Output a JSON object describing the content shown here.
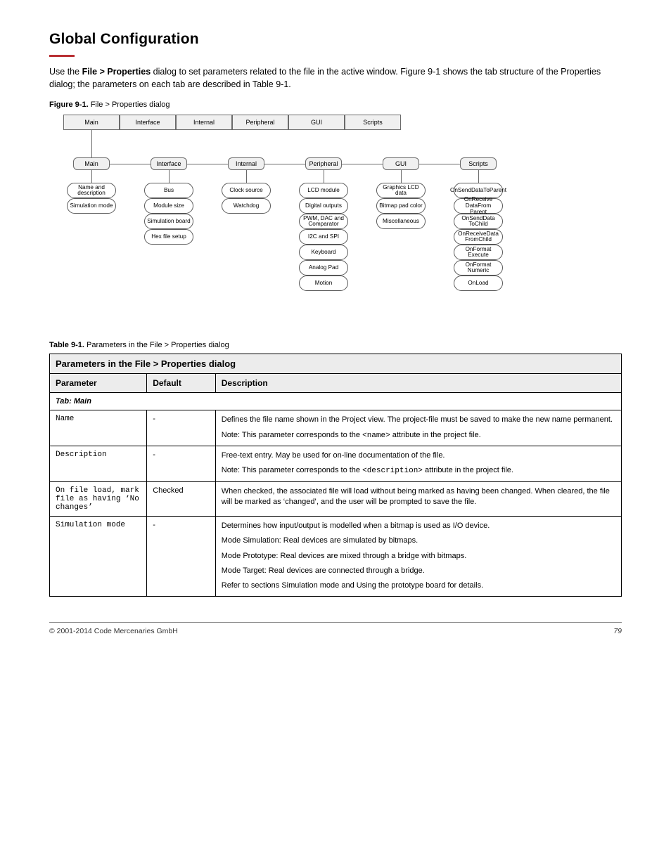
{
  "title": "Global Configuration",
  "intro_parts": [
    "Use the ",
    "File > Properties",
    " dialog to set parameters related to the file in the active window. ",
    "Figure 9-1",
    " shows the tab structure of the Properties dialog; the parameters on each tab are described in ",
    "Table 9-1",
    "."
  ],
  "figure": {
    "label": "Figure 9-1.",
    "caption": "File > Properties dialog"
  },
  "diagram": {
    "top_tabs": [
      "Main",
      "Interface",
      "Internal",
      "Peripheral",
      "GUI",
      "Scripts"
    ],
    "branches": [
      {
        "label": "Main",
        "pills": [
          "Name and description",
          "Simulation mode"
        ]
      },
      {
        "label": "Interface",
        "pills": [
          "Bus",
          "Module size",
          "Simulation board",
          "Hex file setup"
        ]
      },
      {
        "label": "Internal",
        "pills": [
          "Clock source",
          "Watchdog"
        ]
      },
      {
        "label": "Peripheral",
        "pills": [
          "LCD module",
          "Digital outputs",
          "PWM, DAC and Comparator",
          "I2C and SPI",
          "Keyboard",
          "Analog Pad",
          "Motion"
        ]
      },
      {
        "label": "GUI",
        "pills": [
          "Graphics LCD data",
          "Bitmap pad color",
          "Miscellaneous"
        ]
      },
      {
        "label": "Scripts",
        "pills": [
          "OnSendDataToParent",
          "OnReceive DataFrom Parent",
          "OnSendData ToChild",
          "OnReceiveData FromChild",
          "OnFormat Execute",
          "OnFormat Numeric",
          "OnLoad"
        ]
      }
    ]
  },
  "table": {
    "label": "Table 9-1.",
    "caption": "Parameters in the File > Properties dialog",
    "title": "Parameters in the File > Properties dialog",
    "columns": [
      "Parameter",
      "Default",
      "Description"
    ],
    "group": "Tab: Main",
    "rows": [
      {
        "param": "Name",
        "default": "-",
        "desc": [
          "Defines the file name shown in the Project view. The project-file must be saved to make the new name permanent.",
          "Note: This parameter corresponds to the <name> attribute in the project file."
        ],
        "mono_in_desc": "<name>"
      },
      {
        "param": "Description",
        "default": "-",
        "desc": [
          "Free-text entry. May be used for on-line documentation of the file.",
          "Note: This parameter corresponds to the <description> attribute in the project file."
        ],
        "mono_in_desc": "<description>"
      },
      {
        "param": "On file load, mark file as having ‘No changes’",
        "default": "Checked",
        "desc": [
          "When checked, the associated file will load without being marked as having been changed. When cleared, the file will be marked as ‘changed’, and the user will be prompted to save the file."
        ]
      },
      {
        "param": "Simulation mode",
        "default": "-",
        "desc": [
          "Determines how input/output is modelled when a bitmap is used as I/O device.",
          "Mode Simulation: Real devices are simulated by bitmaps.",
          "Mode Prototype: Real devices are mixed through a bridge with bitmaps.",
          "Mode Target: Real devices are connected through a bridge.",
          "Refer to sections Simulation mode and Using the prototype board for details."
        ]
      }
    ]
  },
  "footer": {
    "left": "© 2001-2014 Code Mercenaries GmbH",
    "right": "79"
  }
}
